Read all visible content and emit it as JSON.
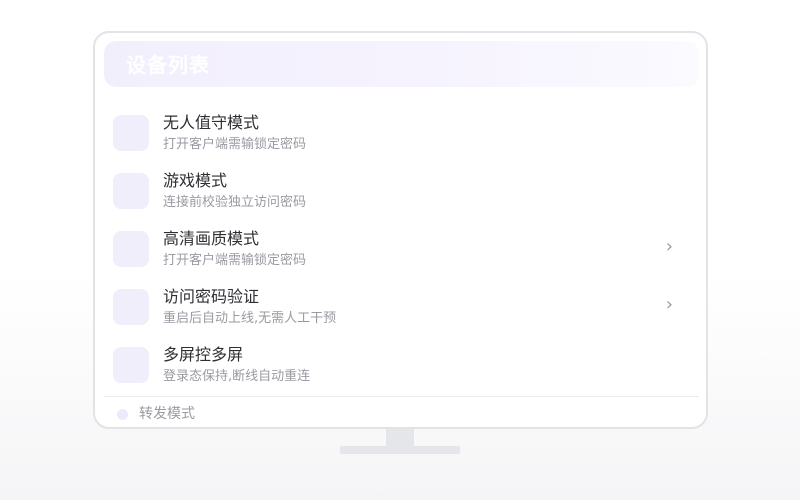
{
  "header": {
    "title": "设备列表"
  },
  "items": [
    {
      "title": "无人值守模式",
      "subtitle": "打开客户端需输锁定密码",
      "chevron": ""
    },
    {
      "title": "游戏模式",
      "subtitle": "连接前校验独立访问密码",
      "chevron": ""
    },
    {
      "title": "高清画质模式",
      "subtitle": "打开客户端需输锁定密码",
      "chevron": "›"
    },
    {
      "title": "访问密码验证",
      "subtitle": "重启后自动上线,无需人工干预",
      "chevron": "›"
    },
    {
      "title": "多屏控多屏",
      "subtitle": "登录态保持,断线自动重连",
      "chevron": ""
    }
  ],
  "footer": {
    "label": "转发模式"
  },
  "icons": {
    "row_icon": "feature-icon",
    "chevron": "chevron-right-icon",
    "footer_dot": "status-dot-icon"
  },
  "colors": {
    "accent_light": "#f1eefc",
    "header_bg": "#f4f1fd",
    "title_text": "#2e2e33",
    "sub_text": "#9a9aa2"
  }
}
